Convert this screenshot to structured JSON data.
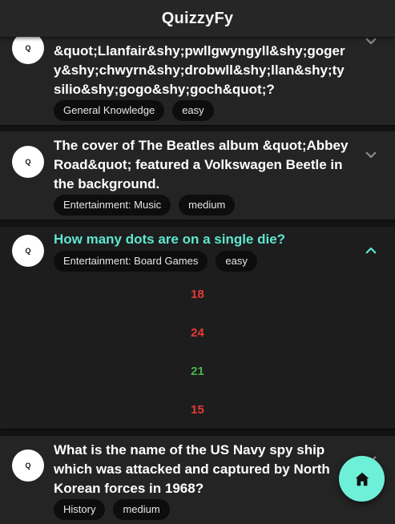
{
  "app": {
    "title": "QuizzyFy"
  },
  "colors": {
    "correct": "#4caf50",
    "incorrect": "#e53935",
    "accent": "#5ee6cf"
  },
  "avatar_label": "Q",
  "cards": [
    {
      "question": "&quot;Llanfair&shy;pwllgwyngyll&shy;gogery&shy;chwyrn&shy;drobwll&shy;llan&shy;tysilio&shy;gogo&shy;goch&quot;?",
      "category": "General Knowledge",
      "difficulty": "easy",
      "chevron": "chevron-down-icon"
    },
    {
      "question": "The cover of The Beatles album &quot;Abbey Road&quot; featured a Volkswagen Beetle in the background.",
      "category": "Entertainment: Music",
      "difficulty": "medium",
      "chevron": "chevron-down-icon"
    },
    {
      "question": "How many dots are on a single die?",
      "category": "Entertainment: Board Games",
      "difficulty": "easy",
      "chevron": "chevron-up-icon",
      "answers": [
        {
          "text": "18",
          "correct": false
        },
        {
          "text": "24",
          "correct": false
        },
        {
          "text": "21",
          "correct": true
        },
        {
          "text": "15",
          "correct": false
        }
      ]
    },
    {
      "question": "What is the name of the US Navy spy ship which was attacked and captured by North Korean forces in 1968?",
      "category": "History",
      "difficulty": "medium",
      "chevron": "chevron-down-icon"
    }
  ],
  "fab": {
    "icon": "home-icon"
  }
}
